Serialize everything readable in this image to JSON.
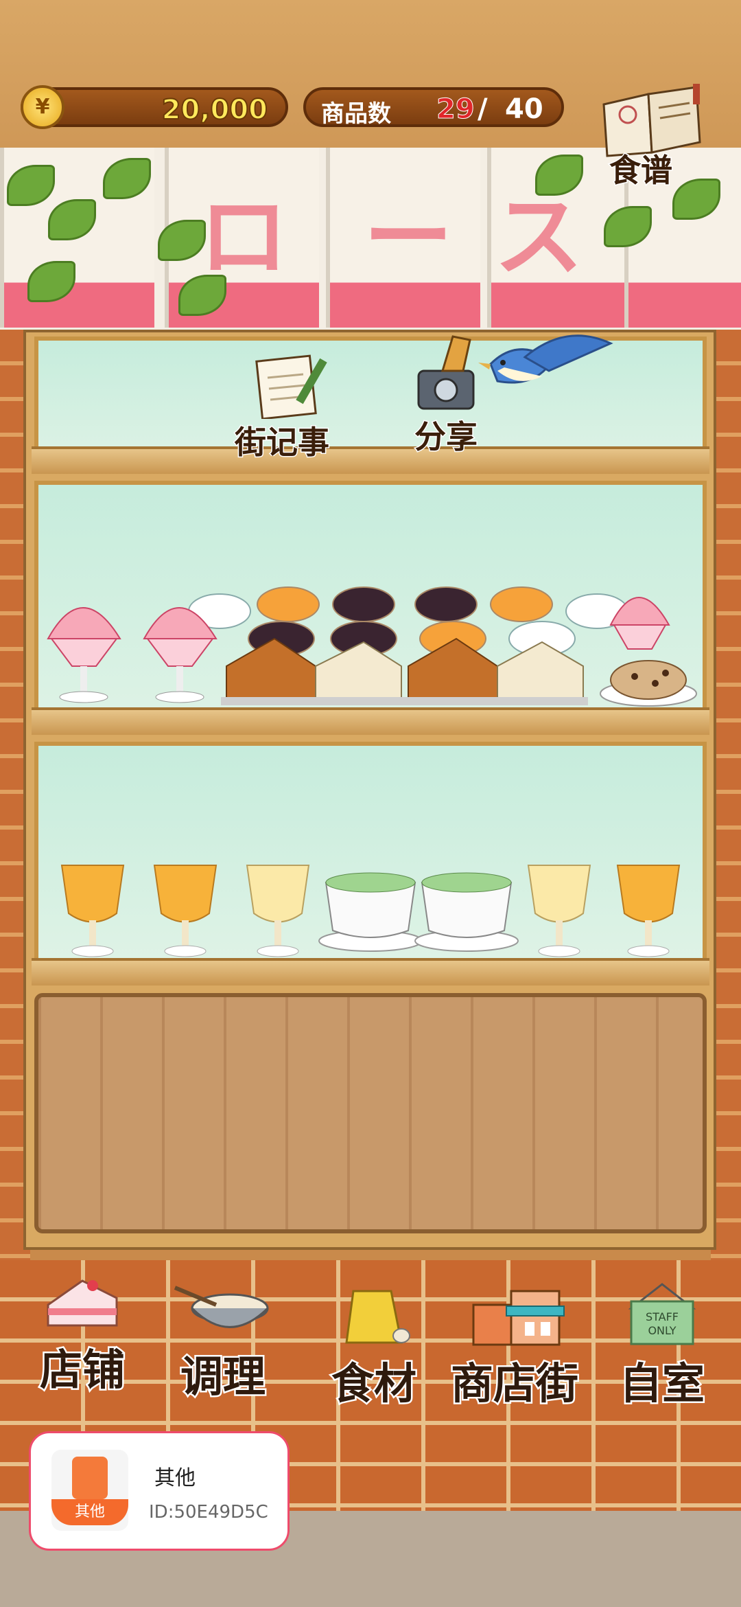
{
  "header": {
    "currency_symbol": "¥",
    "money": "20,000",
    "goods_label": "商品数",
    "goods_count": "29",
    "goods_separator": "/",
    "goods_max": "40",
    "recipe_label": "食谱"
  },
  "sign": {
    "characters": [
      "ロ",
      "ー",
      "ス"
    ]
  },
  "shelf_actions": {
    "news_label": "街记事",
    "share_label": "分享"
  },
  "bottom_nav": [
    {
      "label": "店铺",
      "icon": "cake-icon"
    },
    {
      "label": "调理",
      "icon": "mixing-bowl-icon"
    },
    {
      "label": "食材",
      "icon": "ingredient-bag-icon"
    },
    {
      "label": "商店街",
      "icon": "shop-street-icon"
    },
    {
      "label": "自室",
      "icon": "staff-only-door-icon"
    }
  ],
  "staff_sign": "STAFF ONLY",
  "ad": {
    "badge": "其他",
    "title": "其他",
    "id": "ID:50E49D5C"
  },
  "colors": {
    "money": "#ffe95c",
    "goods_count": "#e1262a",
    "sign_stripe": "#ef6b80",
    "ad_border": "#ee4b6b"
  }
}
